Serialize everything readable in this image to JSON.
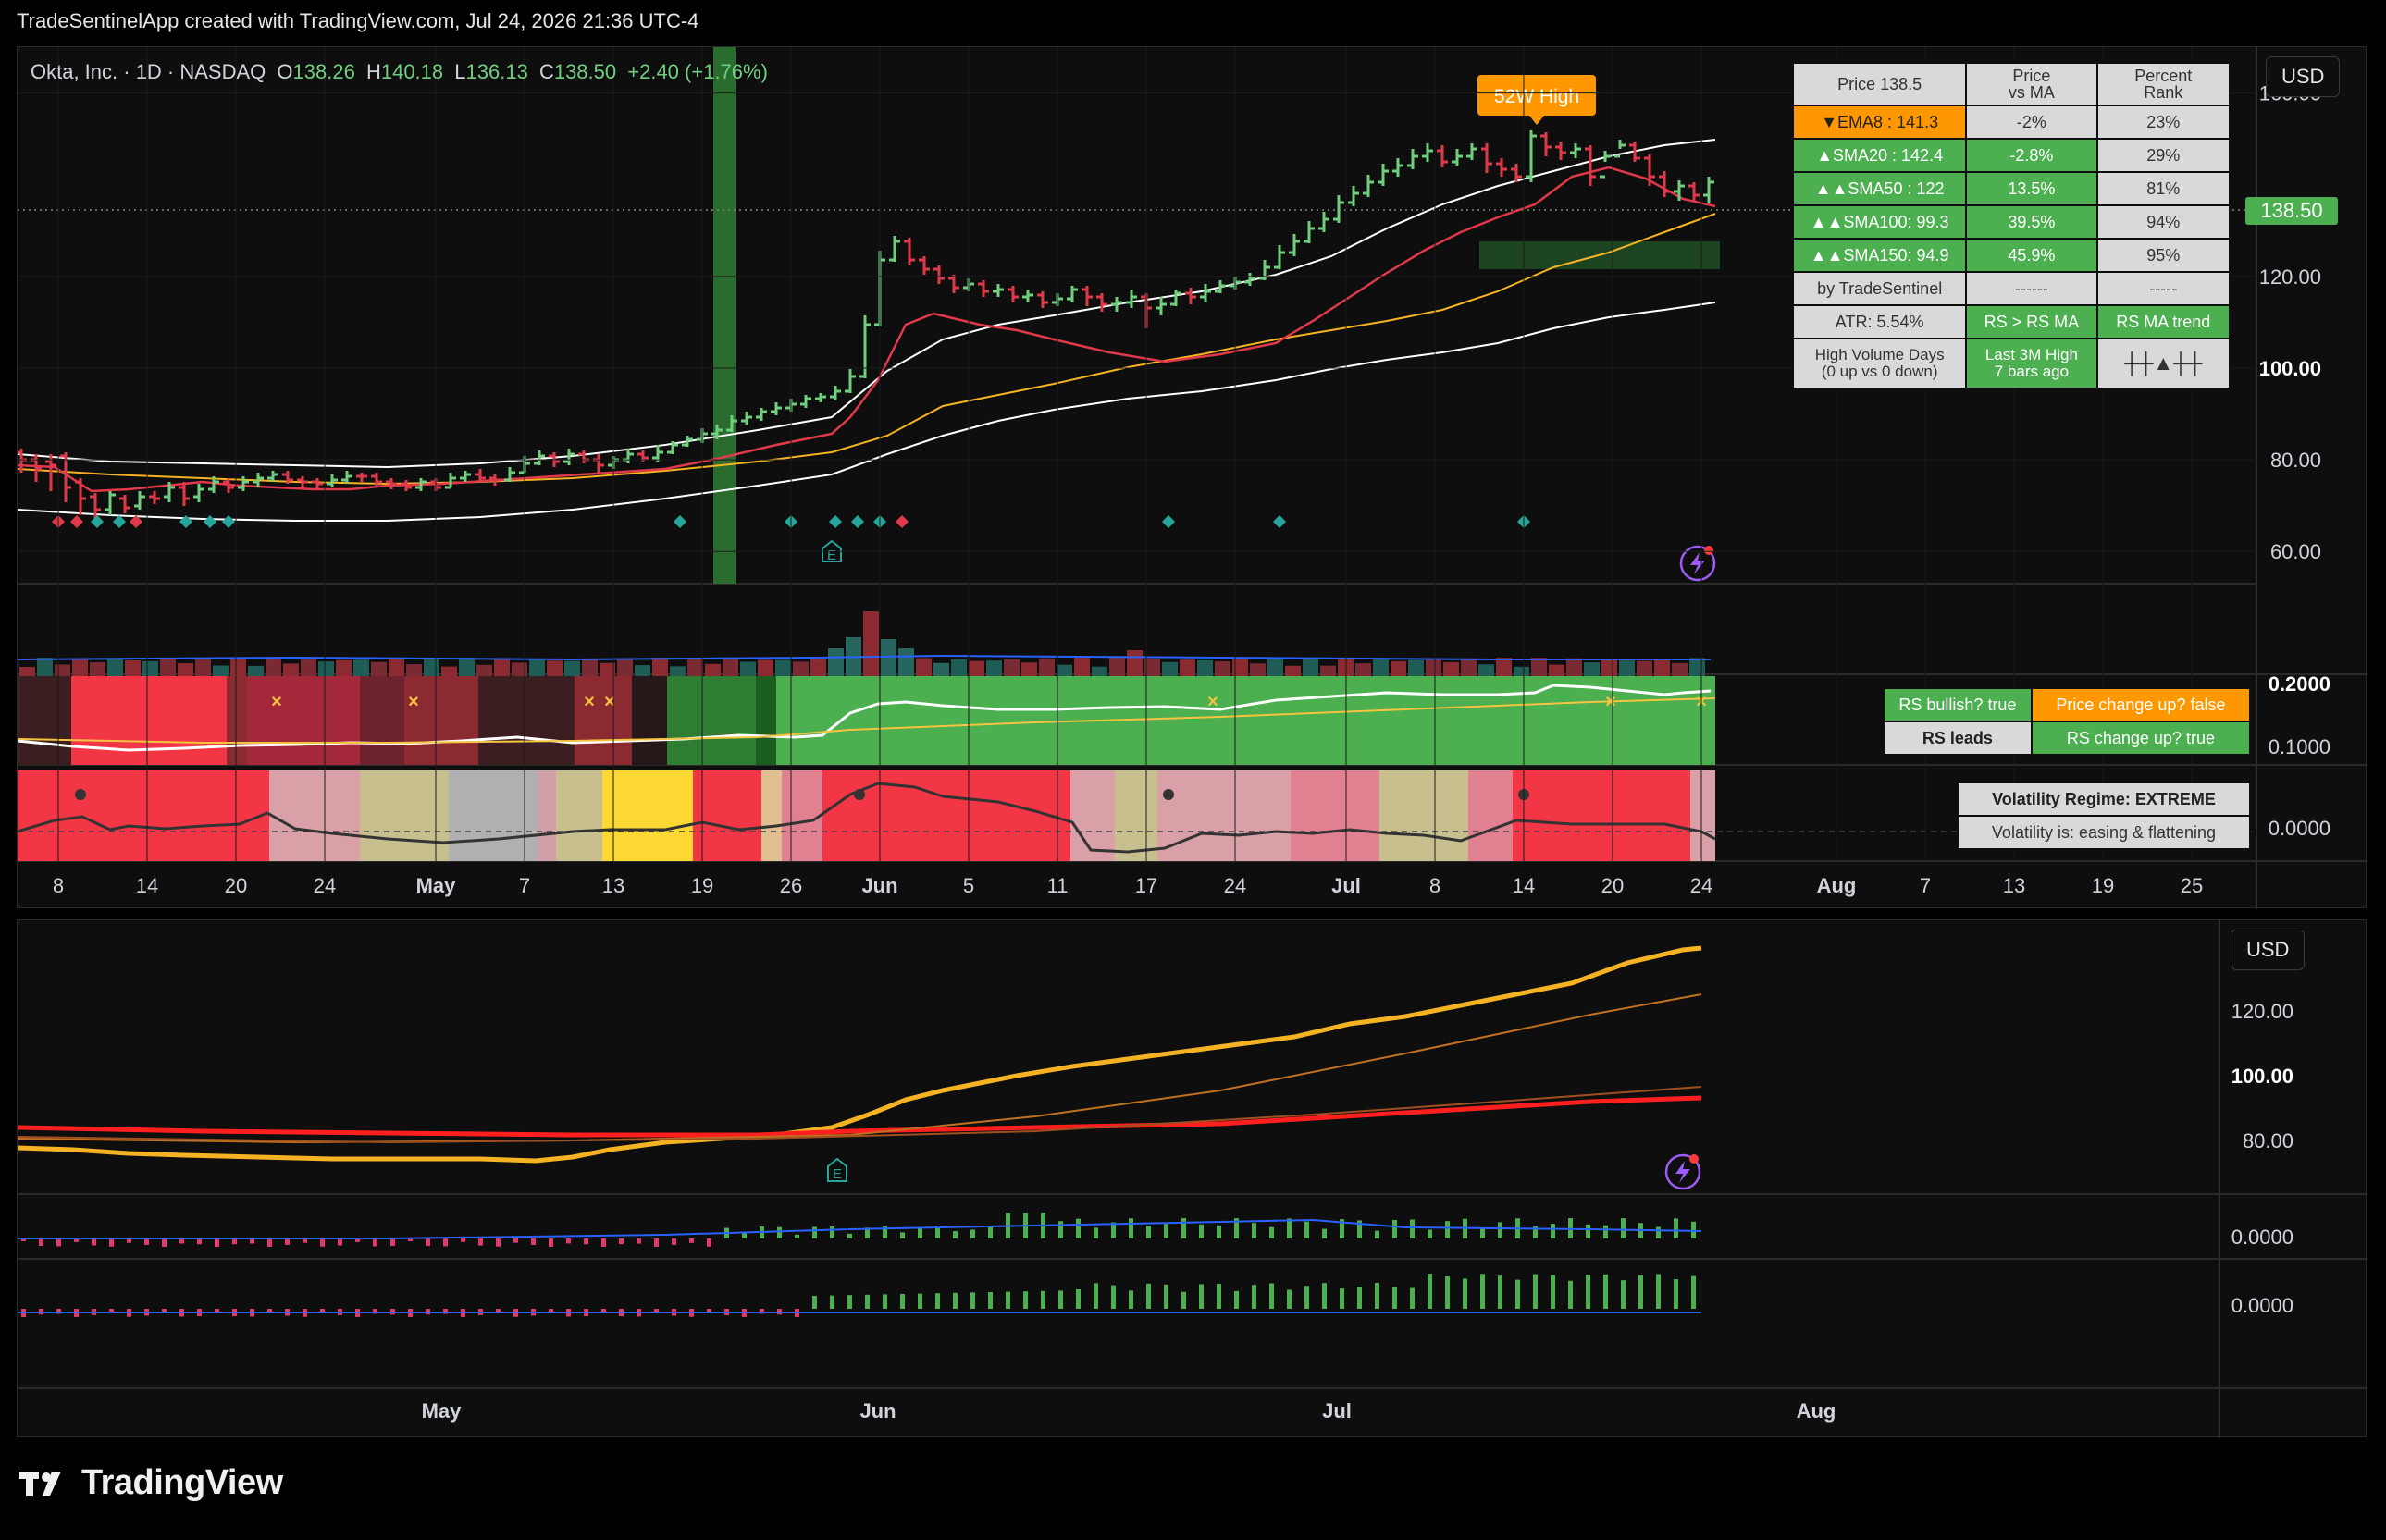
{
  "header": {
    "credit": "TradeSentinelApp created with TradingView.com, Jul 24, 2026 21:36 UTC-4"
  },
  "symbol": {
    "name": "Okta, Inc. · 1D · NASDAQ",
    "open_label": "O",
    "open": "138.26",
    "high_label": "H",
    "high": "140.18",
    "low_label": "L",
    "low": "136.13",
    "close_label": "C",
    "close": "138.50",
    "change": "+2.40 (+1.76%)"
  },
  "currency": "USD",
  "currency_lower": "USD",
  "price_tag": "138.50",
  "high52_label": "52W High",
  "earnings_icon": "E",
  "price_axis": [
    "160.00",
    "120.00",
    "100.00",
    "80.00",
    "60.00"
  ],
  "rs_axis": [
    "0.2000",
    "0.1000"
  ],
  "vol_axis": [
    "0.0000"
  ],
  "lower_axis": [
    "120.00",
    "100.00",
    "80.00",
    "0.0000",
    "0.0000"
  ],
  "date_axis": [
    "8",
    "14",
    "20",
    "24",
    "May",
    "7",
    "13",
    "19",
    "26",
    "Jun",
    "5",
    "11",
    "17",
    "24",
    "Jul",
    "8",
    "14",
    "20",
    "24",
    "Aug",
    "7",
    "13",
    "19",
    "25"
  ],
  "lower_date_axis": [
    "May",
    "Jun",
    "Jul",
    "Aug"
  ],
  "ma_table": {
    "headers": [
      "Price 138.5",
      "Price\nvs MA",
      "Percent\nRank"
    ],
    "rows": [
      [
        "▼EMA8 : 141.3",
        "-2%",
        "23%"
      ],
      [
        "▲SMA20 : 142.4",
        "-2.8%",
        "29%"
      ],
      [
        "▲▲SMA50 : 122",
        "13.5%",
        "81%"
      ],
      [
        "▲▲SMA100: 99.3",
        "39.5%",
        "94%"
      ],
      [
        "▲▲SMA150: 94.9",
        "45.9%",
        "95%"
      ],
      [
        "by TradeSentinel",
        "------",
        "-----"
      ],
      [
        "ATR: 5.54%",
        "RS > RS MA",
        "RS MA trend"
      ],
      [
        "High Volume Days\n(0 up vs 0 down)",
        "Last 3M High\n7 bars ago",
        "┼┼▲┼┼"
      ]
    ]
  },
  "rs_status": {
    "bullish": "RS bullish? true",
    "price_change": "Price change up? false",
    "leads": "RS leads",
    "rs_change": "RS change up? true"
  },
  "volatility": {
    "regime": "Volatility Regime: EXTREME",
    "state": "Volatility is: easing & flattening"
  },
  "footer": {
    "brand": "TradingView"
  },
  "colors": {
    "up": "#6fcf7f",
    "down": "#e0394a",
    "ema": "#ff3b3b",
    "sma50": "#f5b323",
    "band": "#ffffff",
    "orange": "#ff9800",
    "green_bg": "#4caf50",
    "red_bg": "#f23645"
  },
  "chart_data": {
    "type": "line",
    "x_start": "2026-04-06",
    "x_end": "2026-07-24",
    "ylim": [
      55,
      170
    ],
    "close_series": [
      {
        "x": "2026-04-06",
        "o": 84,
        "h": 86,
        "l": 80,
        "c": 82
      },
      {
        "x": "2026-04-08",
        "o": 82,
        "h": 84,
        "l": 74,
        "c": 76
      },
      {
        "x": "2026-04-10",
        "o": 76,
        "h": 78,
        "l": 70,
        "c": 71
      },
      {
        "x": "2026-04-14",
        "o": 71,
        "h": 74,
        "l": 68,
        "c": 72
      },
      {
        "x": "2026-04-17",
        "o": 72,
        "h": 77,
        "l": 71,
        "c": 76
      },
      {
        "x": "2026-04-20",
        "o": 76,
        "h": 79,
        "l": 74,
        "c": 78
      },
      {
        "x": "2026-04-24",
        "o": 77,
        "h": 78,
        "l": 75,
        "c": 76
      },
      {
        "x": "2026-04-28",
        "o": 76,
        "h": 78,
        "l": 74,
        "c": 77
      },
      {
        "x": "2026-05-01",
        "o": 76,
        "h": 77,
        "l": 74,
        "c": 75
      },
      {
        "x": "2026-05-05",
        "o": 75,
        "h": 78,
        "l": 74,
        "c": 77
      },
      {
        "x": "2026-05-08",
        "o": 78,
        "h": 84,
        "l": 77,
        "c": 83
      },
      {
        "x": "2026-05-12",
        "o": 83,
        "h": 84,
        "l": 78,
        "c": 79
      },
      {
        "x": "2026-05-15",
        "o": 80,
        "h": 85,
        "l": 79,
        "c": 84
      },
      {
        "x": "2026-05-19",
        "o": 85,
        "h": 90,
        "l": 84,
        "c": 88
      },
      {
        "x": "2026-05-22",
        "o": 88,
        "h": 93,
        "l": 86,
        "c": 91
      },
      {
        "x": "2026-05-27",
        "o": 91,
        "h": 95,
        "l": 90,
        "c": 93
      },
      {
        "x": "2026-05-29",
        "o": 96,
        "h": 128,
        "l": 95,
        "c": 126
      },
      {
        "x": "2026-06-01",
        "o": 128,
        "h": 144,
        "l": 127,
        "c": 140
      },
      {
        "x": "2026-06-03",
        "o": 138,
        "h": 139,
        "l": 127,
        "c": 129
      },
      {
        "x": "2026-06-05",
        "o": 126,
        "h": 128,
        "l": 121,
        "c": 123
      },
      {
        "x": "2026-06-09",
        "o": 123,
        "h": 124,
        "l": 115,
        "c": 117
      },
      {
        "x": "2026-06-12",
        "o": 117,
        "h": 121,
        "l": 114,
        "c": 118
      },
      {
        "x": "2026-06-16",
        "o": 118,
        "h": 120,
        "l": 112,
        "c": 115
      },
      {
        "x": "2026-06-19",
        "o": 114,
        "h": 118,
        "l": 105,
        "c": 116
      },
      {
        "x": "2026-06-23",
        "o": 116,
        "h": 120,
        "l": 114,
        "c": 118
      },
      {
        "x": "2026-06-26",
        "o": 118,
        "h": 123,
        "l": 117,
        "c": 121
      },
      {
        "x": "2026-06-30",
        "o": 123,
        "h": 133,
        "l": 122,
        "c": 131
      },
      {
        "x": "2026-07-03",
        "o": 133,
        "h": 142,
        "l": 132,
        "c": 140
      },
      {
        "x": "2026-07-07",
        "o": 142,
        "h": 154,
        "l": 140,
        "c": 150
      },
      {
        "x": "2026-07-09",
        "o": 150,
        "h": 153,
        "l": 143,
        "c": 146
      },
      {
        "x": "2026-07-13",
        "o": 140,
        "h": 156,
        "l": 137,
        "c": 152
      },
      {
        "x": "2026-07-15",
        "o": 154,
        "h": 158,
        "l": 147,
        "c": 150
      },
      {
        "x": "2026-07-17",
        "o": 150,
        "h": 155,
        "l": 142,
        "c": 149
      },
      {
        "x": "2026-07-20",
        "o": 145,
        "h": 147,
        "l": 138,
        "c": 140
      },
      {
        "x": "2026-07-22",
        "o": 140,
        "h": 142,
        "l": 134,
        "c": 136
      },
      {
        "x": "2026-07-24",
        "o": 138.26,
        "h": 140.18,
        "l": 136.13,
        "c": 138.5
      }
    ],
    "series": [
      {
        "name": "EMA8",
        "values": [
          [
            0,
            80
          ],
          [
            20,
            75
          ],
          [
            60,
            77
          ],
          [
            100,
            80
          ],
          [
            140,
            86
          ],
          [
            165,
            95
          ],
          [
            180,
            125
          ],
          [
            220,
            122
          ],
          [
            260,
            116
          ],
          [
            300,
            122
          ],
          [
            330,
            135
          ],
          [
            360,
            146
          ],
          [
            380,
            149
          ],
          [
            400,
            143
          ],
          [
            410,
            141.3
          ]
        ]
      },
      {
        "name": "SMA50",
        "values": [
          [
            0,
            80
          ],
          [
            60,
            75
          ],
          [
            120,
            78
          ],
          [
            160,
            84
          ],
          [
            200,
            100
          ],
          [
            260,
            110
          ],
          [
            300,
            117
          ],
          [
            340,
            125
          ],
          [
            380,
            132
          ],
          [
            410,
            137
          ]
        ]
      },
      {
        "name": "SMA20",
        "values": [
          [
            0,
            86
          ],
          [
            60,
            80
          ],
          [
            120,
            82
          ],
          [
            160,
            88
          ],
          [
            200,
            105
          ],
          [
            260,
            120
          ],
          [
            300,
            124
          ],
          [
            340,
            138
          ],
          [
            380,
            148
          ],
          [
            410,
            142.4
          ]
        ]
      },
      {
        "name": "SMA150",
        "values": [
          [
            0,
            70
          ],
          [
            60,
            70
          ],
          [
            120,
            72
          ],
          [
            160,
            76
          ],
          [
            200,
            88
          ],
          [
            260,
            98
          ],
          [
            300,
            106
          ],
          [
            340,
            114
          ],
          [
            380,
            121
          ],
          [
            410,
            127
          ]
        ]
      }
    ]
  }
}
